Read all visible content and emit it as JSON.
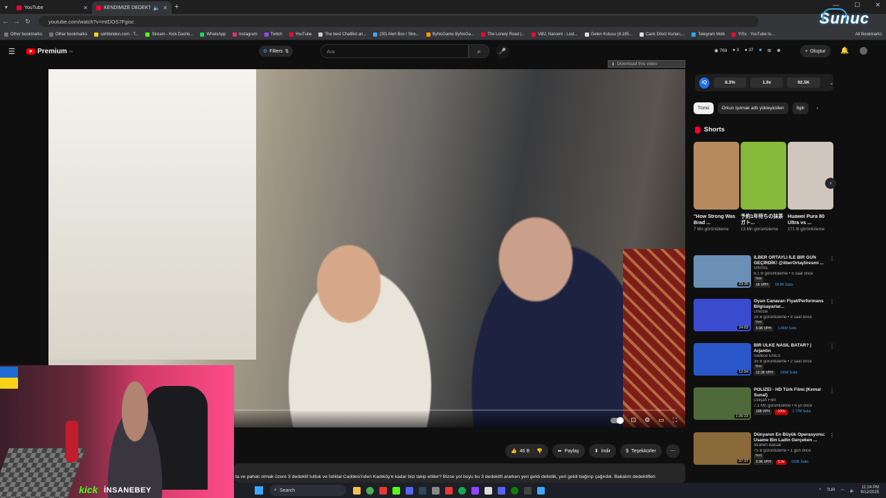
{
  "browser": {
    "tabs": [
      {
        "title": "YouTube",
        "active": false
      },
      {
        "title": "KENDİMİZE DEDEKTİF TUTT",
        "active": true
      }
    ],
    "url": "youtube.com/watch?v=mtDOS7Fgisc",
    "bookmarks": [
      {
        "label": "Other bookmarks",
        "color": "#777777"
      },
      {
        "label": "Other bookmarks",
        "color": "#777777"
      },
      {
        "label": "sahibinden.com - T...",
        "color": "#f7d417"
      },
      {
        "label": "Stream - Kick Dashb...",
        "color": "#53fc18"
      },
      {
        "label": "WhatsApp",
        "color": "#25d366"
      },
      {
        "label": "Instagram",
        "color": "#e1306c"
      },
      {
        "label": "Twitch",
        "color": "#9146ff"
      },
      {
        "label": "YouTube",
        "color": "#ff0033"
      },
      {
        "label": "The best ChatBot an...",
        "color": "#cccccc"
      },
      {
        "label": "(30) Alert Box / Stre...",
        "color": "#3ea6ff"
      },
      {
        "label": "ByNoGame ByNoGa...",
        "color": "#ff9900"
      },
      {
        "label": "The Lonely Road |...",
        "color": "#ff0033"
      },
      {
        "label": "VØJ, Narvent - Lost...",
        "color": "#ff0033"
      },
      {
        "label": "Gelen Kutusu (8.185...",
        "color": "#dddddd"
      },
      {
        "label": "Canlı Döviz Kurları,...",
        "color": "#dddddd"
      },
      {
        "label": "Telegram Web",
        "color": "#2aabee"
      },
      {
        "label": "YtSs - YouTube to...",
        "color": "#ff0033"
      }
    ],
    "all_bookmarks": "All Bookmarks",
    "overlay_logo": "Sunuc"
  },
  "header": {
    "logo_text": "Premium",
    "logo_sup": "TR",
    "filters_label": "Filters",
    "search_placeholder": "Ara",
    "stats": [
      "769",
      "3",
      "37"
    ],
    "create_label": "Oluştur"
  },
  "player": {
    "download_label": "Download this video"
  },
  "actions": {
    "likes": "46 B",
    "share": "Paylaş",
    "download": "İndir",
    "thanks": "Teşekkürler"
  },
  "description_text": "ta ve pahalı olmak üzere 3 dedektif tuttuk ve İstiklal Caddesi'nden Kadıköy'e kadar bizi takip ettiler? Bizse yol boyu bu 3 dedektifi ararken yeri geldi delirdik, yeri geldi bağırıp çağırdık. Bakalım dedektifleri",
  "extension": {
    "logo": "iQ",
    "stats": [
      "8.3%",
      "1.9x",
      "92.5K"
    ]
  },
  "chips": [
    "Tümü",
    "Orkun Işıtmak adlı yükleyiciden",
    "İlgili"
  ],
  "shorts": {
    "heading": "Shorts",
    "items": [
      {
        "title": "\"How Strong Was Brad ...",
        "views": "7 Mn görüntüleme",
        "color": "#b68a5e"
      },
      {
        "title": "予約1年待ちの抹茶ガト...",
        "views": "13 Mn görüntüleme",
        "color": "#86b83a"
      },
      {
        "title": "Huawei Pura 80 Ultra vs ...",
        "views": "171 B görüntüleme",
        "color": "#cfc7bd"
      }
    ]
  },
  "recommendations": [
    {
      "title": "İLBER ORTAYLI İLE BİR GÜN GEÇİRDİK! @ilberOrtayliresmi ...",
      "channel": "SINYAL",
      "meta": "6,1 B görüntüleme • 5 saat önce",
      "duration": "23:35",
      "new": "Yeni",
      "vph": "1K VPH",
      "extra": "58.9K Subs",
      "extra2": "",
      "color": "#6c8fb5"
    },
    {
      "title": "Oyun Canavarı Fiyat/Performans Bilgisayarlar...",
      "channel": "Unioste",
      "meta": "28 B görüntüleme • 4 saat önce",
      "duration": "24:03",
      "new": "Yeni",
      "vph": "5.9K VPH",
      "extra": "1.86M Subs",
      "extra2": "",
      "color": "#3a4bd0"
    },
    {
      "title": "BİR ÜLKE NASIL BATAR? | Arjantin",
      "channel": "Sadece ENES",
      "meta": "35 B görüntüleme • 2 saat önce",
      "duration": "12:04",
      "new": "Yeni",
      "vph": "12.3K VPH",
      "extra": "136M Subs",
      "extra2": "",
      "color": "#2a57c9"
    },
    {
      "title": "POLİZEİ - HD Türk Filmi (Kemal Sunal)",
      "channel": "Gülşah Film",
      "meta": "7,1 Mn görüntüleme • 6 yıl önce",
      "duration": "1:26:23",
      "new": "",
      "vph": "108 VPH",
      "extra": "-100x",
      "extra2": "1.77M Subs",
      "color": "#4f6a3a"
    },
    {
      "title": "Dünyanın En Büyük Operasyonu: Usame Bin Ladin Gerçeken ...",
      "channel": "İbrahim Balsak",
      "meta": "75 B görüntüleme • 1 gün önce",
      "duration": "37:37",
      "new": "Yeni",
      "vph": "2.9K VPH",
      "extra": "5.9x",
      "extra2": "633K Subs",
      "color": "#8a6a3a"
    }
  ],
  "stream": {
    "platform": "kick",
    "username": "İNSANEBEY"
  },
  "taskbar": {
    "search": "Search",
    "lang": "TUR",
    "time": "11:24 PM",
    "date": "9/12/2025"
  }
}
